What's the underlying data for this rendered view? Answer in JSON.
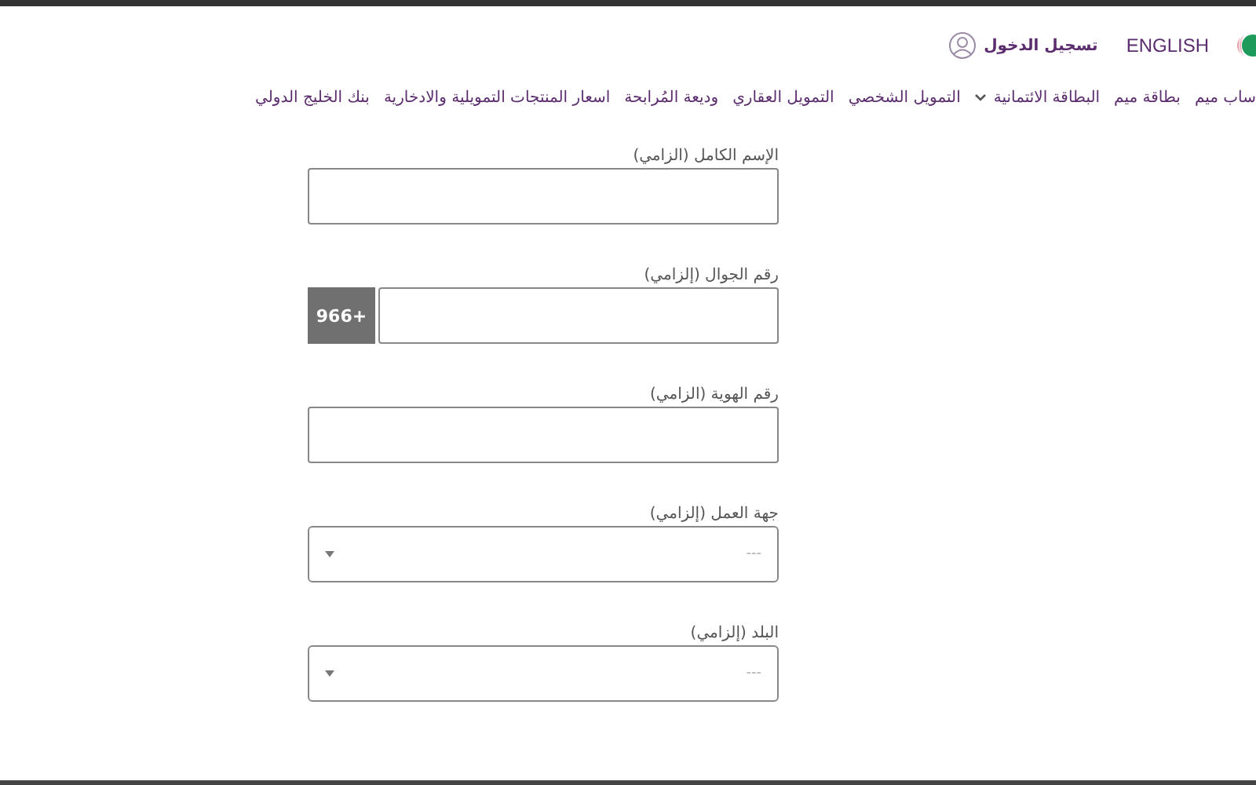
{
  "header": {
    "language_link": "ENGLISH",
    "login_link": "تسجيل الدخول"
  },
  "nav": [
    {
      "label": "ساب ميم",
      "has_menu": false
    },
    {
      "label": "بطاقة ميم",
      "has_menu": false
    },
    {
      "label": "البطاقة الائتمانية",
      "has_menu": true
    },
    {
      "label": "التمويل الشخصي",
      "has_menu": false
    },
    {
      "label": "التمويل العقاري",
      "has_menu": false
    },
    {
      "label": "وديعة المُرابحة",
      "has_menu": false
    },
    {
      "label": "اسعار المنتجات التمويلية والادخارية",
      "has_menu": false
    },
    {
      "label": "بنك الخليج الدولي",
      "has_menu": false
    }
  ],
  "form": {
    "fields": [
      {
        "kind": "text",
        "label": "الإسم الكامل (الزامي)"
      },
      {
        "kind": "phone",
        "label": "رقم الجوال (إلزامي)",
        "prefix": "966+"
      },
      {
        "kind": "text",
        "label": "رقم الهوية (الزامي)"
      },
      {
        "kind": "select",
        "label": "جهة العمل (إلزامي)",
        "placeholder": "---"
      },
      {
        "kind": "select",
        "label": "البلد (إلزامي)",
        "placeholder": "---"
      }
    ]
  }
}
